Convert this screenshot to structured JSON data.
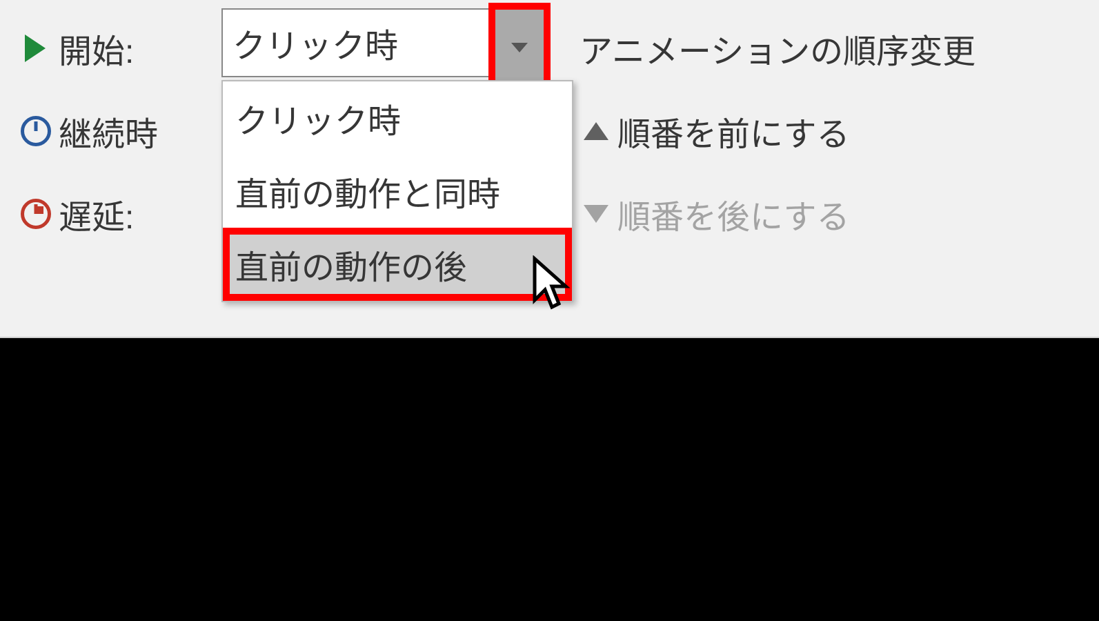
{
  "timing": {
    "start_label": "開始:",
    "duration_label": "継続時",
    "delay_label": "遅延:",
    "start_value": "クリック時",
    "options": [
      "クリック時",
      "直前の動作と同時",
      "直前の動作の後"
    ]
  },
  "reorder": {
    "header": "アニメーションの順序変更",
    "move_earlier": "順番を前にする",
    "move_later": "順番を後にする"
  }
}
